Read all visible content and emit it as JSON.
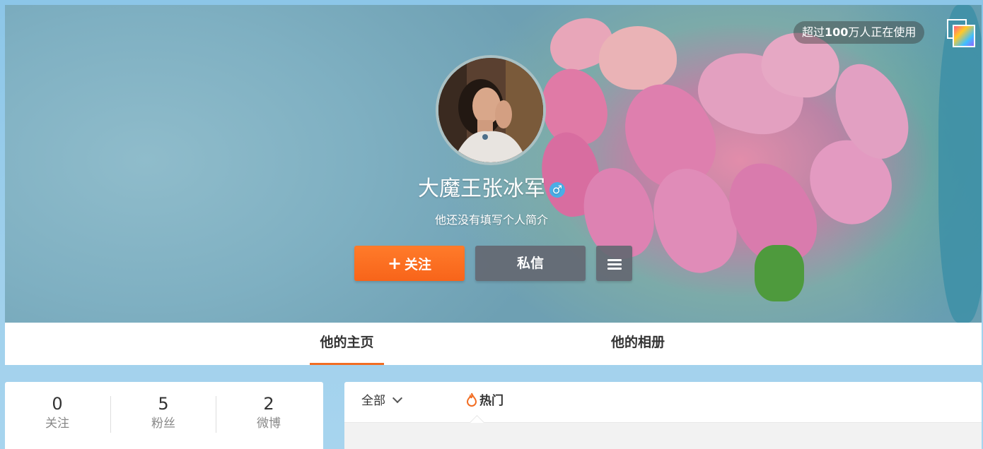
{
  "cover": {
    "users_badge_prefix": "超过",
    "users_badge_number": "100",
    "users_badge_suffix": "万人正在使用"
  },
  "profile": {
    "name": "大魔王张冰军",
    "gender_symbol": "♂",
    "intro": "他还没有填写个人简介"
  },
  "actions": {
    "follow_label": "关注",
    "follow_icon": "+",
    "message_label": "私信"
  },
  "tabs": [
    {
      "label": "他的主页",
      "active": true
    },
    {
      "label": "他的相册",
      "active": false
    }
  ],
  "stats": [
    {
      "value": "0",
      "label": "关注"
    },
    {
      "value": "5",
      "label": "粉丝"
    },
    {
      "value": "2",
      "label": "微博"
    }
  ],
  "feed": {
    "filter_all": "全部",
    "filter_hot": "热门"
  },
  "colors": {
    "accent": "#f26d22",
    "follow_button": "#f8641a",
    "gender_badge": "#4aaee6"
  }
}
